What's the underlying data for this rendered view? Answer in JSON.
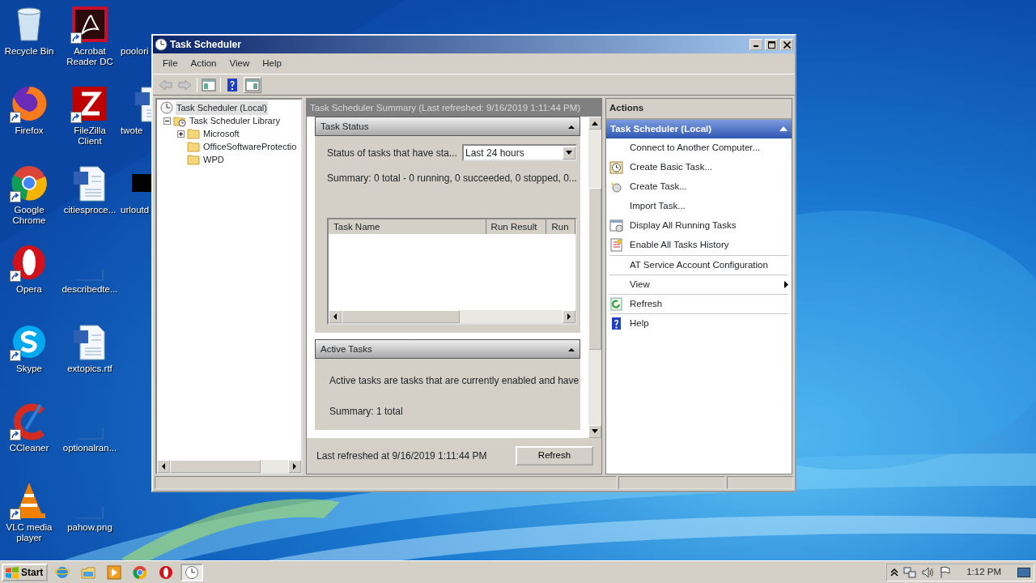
{
  "desktop": {
    "columns": [
      [
        {
          "label": "Recycle Bin",
          "kind": "recycle",
          "shortcut": false
        },
        {
          "label": "Firefox",
          "kind": "firefox",
          "shortcut": true
        },
        {
          "label": "Google Chrome",
          "kind": "chrome",
          "shortcut": true
        },
        {
          "label": "Opera",
          "kind": "opera",
          "shortcut": true
        },
        {
          "label": "Skype",
          "kind": "skype",
          "shortcut": true
        },
        {
          "label": "CCleaner",
          "kind": "ccleaner",
          "shortcut": true
        },
        {
          "label": "VLC media player",
          "kind": "vlc",
          "shortcut": true
        }
      ],
      [
        {
          "label": "Acrobat Reader DC",
          "kind": "pdf",
          "shortcut": true
        },
        {
          "label": "FileZilla Client",
          "kind": "filezilla",
          "shortcut": true
        },
        {
          "label": "citiesproce...",
          "kind": "doc",
          "shortcut": false
        },
        {
          "label": "describedte...",
          "kind": "blank",
          "shortcut": false
        },
        {
          "label": "extopics.rtf",
          "kind": "doc",
          "shortcut": false
        },
        {
          "label": "optionalran...",
          "kind": "blank",
          "shortcut": false
        },
        {
          "label": "pahow.png",
          "kind": "blank",
          "shortcut": false
        }
      ],
      [
        {
          "label": "poolori",
          "kind": "covered"
        },
        {
          "label": "twote",
          "kind": "doc"
        },
        {
          "label": "urloutd",
          "kind": "black"
        }
      ]
    ]
  },
  "window": {
    "title": "Task Scheduler",
    "menu": [
      "File",
      "Action",
      "View",
      "Help"
    ],
    "toolbar": [
      {
        "kind": "back",
        "disabled": true
      },
      {
        "kind": "forward",
        "disabled": true
      },
      {
        "kind": "tree",
        "disabled": false
      },
      {
        "kind": "help",
        "disabled": false
      },
      {
        "kind": "actionpane",
        "disabled": false
      }
    ],
    "tree": [
      {
        "label": "Task Scheduler (Local)",
        "kind": "root",
        "selected": true,
        "children": [
          {
            "label": "Task Scheduler Library",
            "kind": "library",
            "expanded": true,
            "selected": false,
            "children": [
              {
                "label": "Microsoft",
                "kind": "folder",
                "expanded": false,
                "selected": false
              },
              {
                "label": "OfficeSoftwareProtectio",
                "kind": "leaf",
                "selected": false
              },
              {
                "label": "WPD",
                "kind": "leaf",
                "selected": false
              }
            ]
          }
        ]
      }
    ],
    "summary": {
      "header": "Task Scheduler Summary (Last refreshed: 9/16/2019 1:11:44 PM)",
      "task_status": {
        "title": "Task Status",
        "expanded": true,
        "filter_label": "Status of tasks that have sta...",
        "filter_value": "Last 24 hours",
        "summary": "Summary: 0 total - 0 running, 0 succeeded, 0 stopped, 0...",
        "columns": [
          "Task Name",
          "Run Result",
          "Run"
        ]
      },
      "active_tasks": {
        "title": "Active Tasks",
        "expanded": true,
        "description": "Active tasks are tasks that are currently enabled and have",
        "summary": "Summary: 1 total"
      },
      "footer": "Last refreshed at 9/16/2019 1:11:44 PM",
      "refresh_button": "Refresh"
    },
    "actions": {
      "heading": "Actions",
      "group": "Task Scheduler (Local)",
      "group_expanded": true,
      "items": [
        {
          "label": "Connect to Another Computer...",
          "kind": "plain",
          "submenu": false,
          "separator_above": false
        },
        {
          "label": "Create Basic Task...",
          "kind": "basic",
          "submenu": false,
          "separator_above": false
        },
        {
          "label": "Create Task...",
          "kind": "create",
          "submenu": false,
          "separator_above": false
        },
        {
          "label": "Import Task...",
          "kind": "plain",
          "submenu": false,
          "separator_above": false
        },
        {
          "label": "Display All Running Tasks",
          "kind": "running",
          "submenu": false,
          "separator_above": false
        },
        {
          "label": "Enable All Tasks History",
          "kind": "history",
          "submenu": false,
          "separator_above": false
        },
        {
          "label": "AT Service Account Configuration",
          "kind": "plain",
          "submenu": false,
          "separator_above": true
        },
        {
          "label": "View",
          "kind": "plain",
          "submenu": true,
          "separator_above": true
        },
        {
          "label": "Refresh",
          "kind": "refresh",
          "submenu": false,
          "separator_above": true
        },
        {
          "label": "Help",
          "kind": "help",
          "submenu": false,
          "separator_above": true
        }
      ]
    }
  },
  "taskbar": {
    "start": "Start",
    "apps": [
      {
        "kind": "ie",
        "selected": false
      },
      {
        "kind": "explorer",
        "selected": false
      },
      {
        "kind": "media",
        "selected": false
      },
      {
        "kind": "chrome",
        "selected": false
      },
      {
        "kind": "opera",
        "selected": false
      },
      {
        "kind": "clock",
        "selected": true
      }
    ],
    "clock": "1:12 PM"
  }
}
